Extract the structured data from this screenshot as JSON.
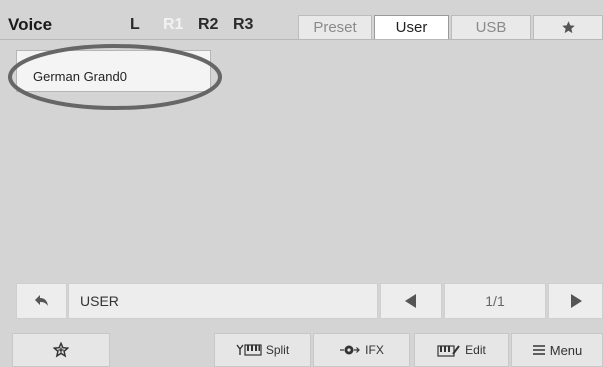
{
  "header": {
    "title": "Voice",
    "parts": [
      {
        "label": "L",
        "active": false
      },
      {
        "label": "R1",
        "active": true
      },
      {
        "label": "R2",
        "active": false
      },
      {
        "label": "R3",
        "active": false
      }
    ],
    "tabs": [
      {
        "label": "Preset",
        "active": false
      },
      {
        "label": "User",
        "active": true
      },
      {
        "label": "USB",
        "active": false
      },
      {
        "label": "",
        "icon": "star-icon",
        "active": false
      }
    ]
  },
  "voices": [
    {
      "name": "German Grand0",
      "selected": true
    }
  ],
  "navigation": {
    "location": "USER",
    "page": "1/1",
    "back_icon": "back-arrow-icon",
    "prev_icon": "triangle-left-icon",
    "next_icon": "triangle-right-icon"
  },
  "function_bar": {
    "favorite_icon": "star-outline-icon",
    "split_label": "Split",
    "ifx_label": "IFX",
    "edit_label": "Edit",
    "menu_label": "Menu"
  },
  "colors": {
    "background": "#d4d4d4",
    "active_part": "#f2f2f2",
    "tab_active": "#ffffff",
    "highlight_ellipse": "#666666"
  }
}
